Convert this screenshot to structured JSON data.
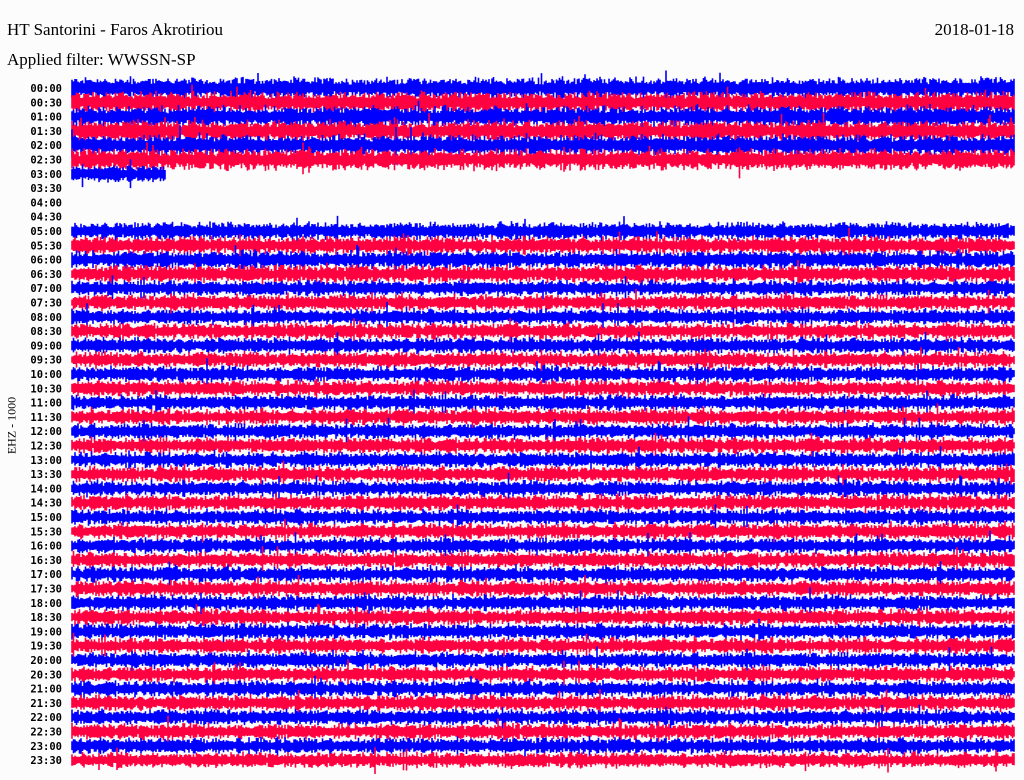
{
  "header": {
    "station": "HT Santorini - Faros Akrotiriou",
    "date": "2018-01-18",
    "filter": "Applied filter: WWSSN-SP"
  },
  "chart_data": {
    "type": "line",
    "title": "HT Santorini - Faros Akrotiriou",
    "ylabel": "EHZ - 1000",
    "trace_interval_minutes": 30,
    "row_labels": [
      "00:00",
      "00:30",
      "01:00",
      "01:30",
      "02:00",
      "02:30",
      "03:00",
      "03:30",
      "04:00",
      "04:30",
      "05:00",
      "05:30",
      "06:00",
      "06:30",
      "07:00",
      "07:30",
      "08:00",
      "08:30",
      "09:00",
      "09:30",
      "10:00",
      "10:30",
      "11:00",
      "11:30",
      "12:00",
      "12:30",
      "13:00",
      "13:30",
      "14:00",
      "14:30",
      "15:00",
      "15:30",
      "16:00",
      "16:30",
      "17:00",
      "17:30",
      "18:00",
      "18:30",
      "19:00",
      "19:30",
      "20:00",
      "20:30",
      "21:00",
      "21:30",
      "22:00",
      "22:30",
      "23:00",
      "23:30"
    ],
    "colors": [
      "#0000ff",
      "#ff0040"
    ],
    "data_gap": {
      "start": "03:03",
      "end": "05:00"
    },
    "grid": false
  }
}
